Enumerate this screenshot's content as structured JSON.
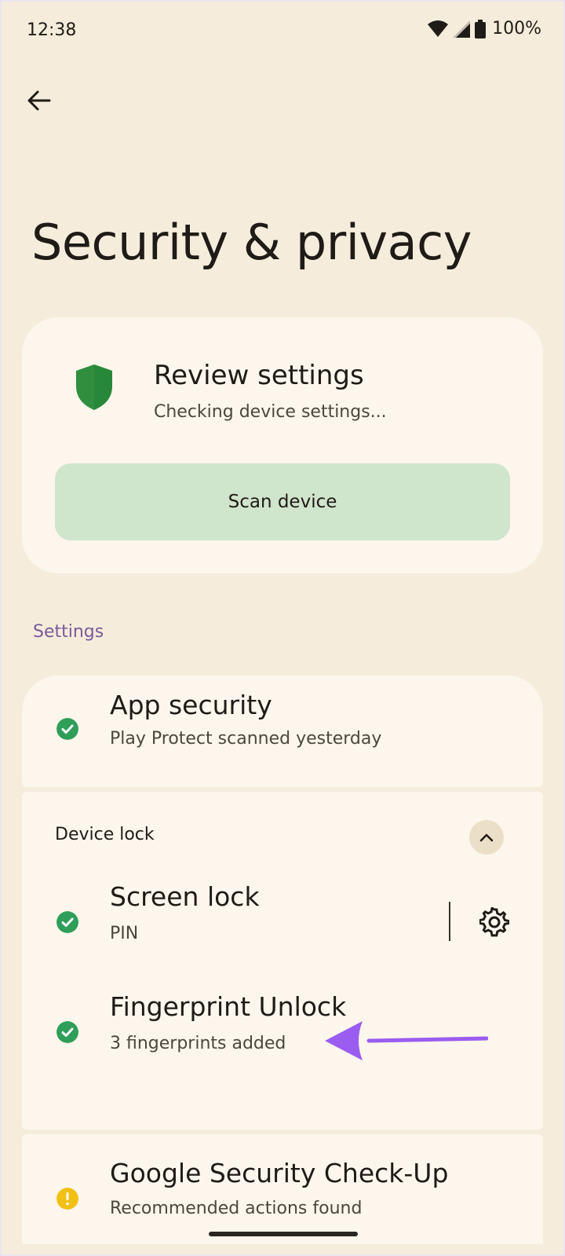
{
  "status_bar": {
    "time": "12:38",
    "battery": "100%",
    "icons": [
      "wifi-icon",
      "signal-icon",
      "battery-icon"
    ]
  },
  "header": {
    "back_icon": "arrow-back-icon",
    "title": "Security & privacy"
  },
  "review_card": {
    "icon": "shield-icon",
    "title": "Review settings",
    "subtitle": "Checking device settings...",
    "scan_button_label": "Scan device"
  },
  "settings": {
    "section_label": "Settings",
    "app_security": {
      "title": "App security",
      "subtitle": "Play Protect scanned yesterday",
      "status": "ok"
    },
    "device_lock": {
      "label": "Device lock",
      "expanded": true,
      "items": [
        {
          "title": "Screen lock",
          "subtitle": "PIN",
          "status": "ok",
          "has_settings": true
        },
        {
          "title": "Fingerprint Unlock",
          "subtitle": "3 fingerprints added",
          "status": "ok",
          "has_settings": false
        }
      ]
    },
    "google_checkup": {
      "title": "Google Security Check-Up",
      "subtitle": "Recommended actions found",
      "status": "warning"
    }
  },
  "colors": {
    "background": "#f6ecdb",
    "card": "#fdf6ec",
    "ok_green": "#2f9e58",
    "warning_yellow": "#f2c014",
    "accent_purple": "#7a5a9c",
    "scan_button": "#cfe5cc",
    "annotation_arrow": "#9b5cf0"
  }
}
